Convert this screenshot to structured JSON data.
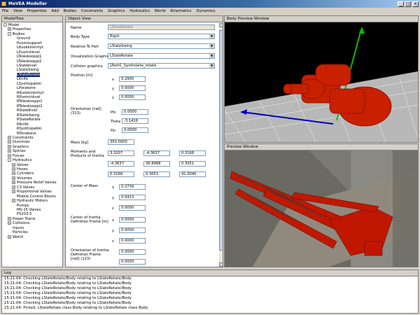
{
  "window": {
    "title": "MeVEA Modeller"
  },
  "menu": [
    "File",
    "View",
    "Properties",
    "Add",
    "Bodies",
    "Constraints",
    "Graphics",
    "Hydraulics",
    "World",
    "Kinematics",
    "Dynamics"
  ],
  "tree": {
    "title": "ModelTree",
    "items": [
      {
        "label": "Model",
        "indent": 0,
        "exp": "-"
      },
      {
        "label": "Properties",
        "indent": 1,
        "exp": "+"
      },
      {
        "label": "Bodies",
        "indent": 1,
        "exp": "-"
      },
      {
        "label": "Ground",
        "indent": 2
      },
      {
        "label": "Puomisupport",
        "indent": 2
      },
      {
        "label": "LKuokkinknhyt",
        "indent": 2
      },
      {
        "label": "LPuominkvel",
        "indent": 2
      },
      {
        "label": "LTeleskooppi1",
        "indent": 2
      },
      {
        "label": "LTeleskooppi2",
        "indent": 2
      },
      {
        "label": "LSlatekivel",
        "indent": 2
      },
      {
        "label": "LSlateSwing",
        "indent": 2
      },
      {
        "label": "LSlateRotate",
        "indent": 2,
        "sel": true
      },
      {
        "label": "LKnife",
        "indent": 2
      },
      {
        "label": "LSyottopalkki",
        "indent": 2
      },
      {
        "label": "LPorakone",
        "indent": 2
      },
      {
        "label": "RKuokkinknhyt",
        "indent": 2
      },
      {
        "label": "RPuominkvel",
        "indent": 2
      },
      {
        "label": "RTeleskooppi1",
        "indent": 2
      },
      {
        "label": "RTeleskooppi2",
        "indent": 2
      },
      {
        "label": "RSlateKivel",
        "indent": 2
      },
      {
        "label": "RSlateSwing",
        "indent": 2
      },
      {
        "label": "RSlateRotate",
        "indent": 2
      },
      {
        "label": "RKnife",
        "indent": 2
      },
      {
        "label": "RSyottopalkki",
        "indent": 2
      },
      {
        "label": "RPorakone",
        "indent": 2
      },
      {
        "label": "Constraints",
        "indent": 1,
        "exp": "+"
      },
      {
        "label": "Dummies",
        "indent": 1,
        "exp": "+"
      },
      {
        "label": "Graphics",
        "indent": 1,
        "exp": "+"
      },
      {
        "label": "Splines",
        "indent": 1,
        "exp": "+"
      },
      {
        "label": "Forces",
        "indent": 1,
        "exp": "+"
      },
      {
        "label": "Hydraulics",
        "indent": 1,
        "exp": "-"
      },
      {
        "label": "Valves",
        "indent": 2,
        "exp": "+"
      },
      {
        "label": "Hoses",
        "indent": 2,
        "exp": "+"
      },
      {
        "label": "Cylinders",
        "indent": 2,
        "exp": "+"
      },
      {
        "label": "Volumes",
        "indent": 2,
        "exp": "+"
      },
      {
        "label": "Pressure Relief Valves",
        "indent": 2,
        "exp": "+"
      },
      {
        "label": "C3 Valves",
        "indent": 2,
        "exp": "+"
      },
      {
        "label": "Proportional Valves",
        "indent": 2,
        "exp": "+"
      },
      {
        "label": "Mobile Control Blocks",
        "indent": 2
      },
      {
        "label": "Hydraulic Motors",
        "indent": 2,
        "exp": "+"
      },
      {
        "label": "Pumps",
        "indent": 2
      },
      {
        "label": "Mk-15 Valves",
        "indent": 2
      },
      {
        "label": "PS203.5",
        "indent": 2
      },
      {
        "label": "Power Trains",
        "indent": 1,
        "exp": "+"
      },
      {
        "label": "Collisions",
        "indent": 1,
        "exp": "+"
      },
      {
        "label": "Inputs",
        "indent": 1
      },
      {
        "label": "Particles",
        "indent": 1
      },
      {
        "label": "World",
        "indent": 1,
        "exp": "+"
      }
    ]
  },
  "objview": {
    "title": "Object View",
    "name_label": "Name",
    "name_value": "LSlateRotate",
    "bodytype_label": "Body Type",
    "bodytype_value": "Rigid",
    "relative_label": "Relative To Part",
    "relative_value": "LSlateSwing",
    "visual_label": "Visualization Graphics",
    "visual_value": "LSlateRotate",
    "collision_label": "Collision graphics",
    "collision_value": "LTeshC_Syottolaite_rotate",
    "position_label": "Position [m]",
    "position": {
      "x": "0.2900",
      "y": "0.0000",
      "z": "0.0000"
    },
    "orientation_label": "Orientation [rad] (313)",
    "orientation": {
      "phi_label": "Phi",
      "phi": "0.0000",
      "theta_label": "Theta",
      "theta": "-3.1416",
      "psi_label": "Psi",
      "psi": "0.0000"
    },
    "mass_label": "Mass [kg]",
    "mass": "350.0000",
    "inertia_label": "Moments and Products of Inertia",
    "inertia": [
      [
        "3.3207",
        "-4.3637",
        "0.3168"
      ],
      [
        "-4.3637",
        "36.8988",
        "0.3051"
      ],
      [
        "0.3168",
        "0.3051",
        "41.0040"
      ]
    ],
    "com_label": "Center of Mass",
    "com": {
      "x": "0.2739",
      "y": "0.0413",
      "z": "0.0000"
    },
    "cif_label": "Center of Inertia Definition Frame [m]",
    "cif": {
      "x": "0.0000",
      "y": "0.0000",
      "z": "0.0000"
    },
    "oif_label": "Orientation of Inertia Definition Frame [rad] (123)",
    "oif": {
      "a": "0.0000",
      "b": "0.0000"
    },
    "axis": {
      "x": "x",
      "y": "y",
      "z": "z"
    }
  },
  "bodyprev": {
    "title": "Body Preview Window"
  },
  "prevwin": {
    "title": "Preview Window"
  },
  "log": {
    "title": "Log",
    "lines": [
      "15:21:04: Checking LSlateRotate/Body relating to LSlateRotate/Body",
      "15:21:04: Checking LSlateRotate/Body relating to LSlateRotate/Body",
      "15:21:04: Checking LSlateRotate/Body relating to LSlateRotate/Body",
      "15:21:04: Checking LSlateRotate/Body relating to LSlateRotate/Body",
      "15:21:04: Checking LSlateRotate/Body relating to LSlateRotate/Body",
      "15:21:04: Checking LSlateRotate/Body relating to LSlateRotate/Body",
      "15:21:04: Picked, LSlateRotate class Body relating to LSlateRotate class Body"
    ]
  },
  "colors": {
    "title_start": "#0a246a",
    "body_red": "#c82000",
    "selection": "#0a246a"
  }
}
